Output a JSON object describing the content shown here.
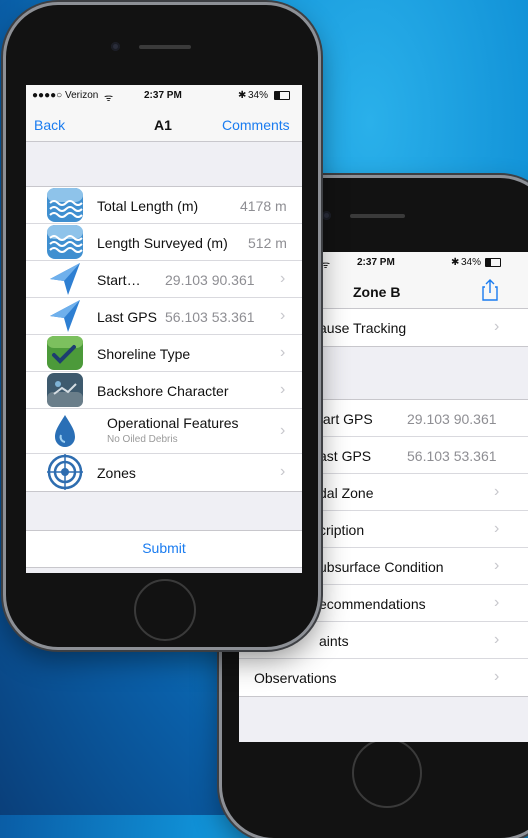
{
  "colors": {
    "accent": "#1a7cf0",
    "background": "#0c78c8"
  },
  "phone_front": {
    "status": {
      "carrier": "●●●●○ Verizon",
      "wifi_icon": "wifi-icon",
      "time": "2:37 PM",
      "bluetooth": "✱",
      "battery": "34%"
    },
    "nav": {
      "back": "Back",
      "title": "A1",
      "comments": "Comments"
    },
    "rows": [
      {
        "icon": "water-waves-icon",
        "label": "Total Length (m)",
        "value": "4178 m"
      },
      {
        "icon": "water-waves-icon",
        "label": "Length Surveyed (m)",
        "value": "512 m"
      },
      {
        "icon": "location-arrow-icon",
        "label": "Start…",
        "value": "29.103 90.361"
      },
      {
        "icon": "location-arrow-icon",
        "label": "Last GPS",
        "value": "56.103 53.361"
      },
      {
        "icon": "shoreline-photo-icon",
        "label": "Shoreline Type",
        "value": ""
      },
      {
        "icon": "backshore-photo-icon",
        "label": "Backshore Character",
        "value": ""
      },
      {
        "icon": "oil-drop-icon",
        "label": "Operational Features",
        "sublabel": "No Oiled Debris",
        "value": ""
      },
      {
        "icon": "target-icon",
        "label": "Zones",
        "value": ""
      }
    ],
    "submit": "Submit"
  },
  "phone_back": {
    "status": {
      "time": "2:37 PM",
      "bluetooth": "✱",
      "battery": "34%"
    },
    "nav": {
      "title": "Zone B",
      "share_icon": "share-icon"
    },
    "group1": [
      {
        "label": "ause Tracking"
      }
    ],
    "group2": [
      {
        "label": "tart GPS",
        "value": "29.103 90.361"
      },
      {
        "label": "ast GPS",
        "value": "56.103 53.361"
      },
      {
        "label": "dal Zone",
        "value": ""
      },
      {
        "label": "cription",
        "value": ""
      },
      {
        "label": "ubsurface Condition",
        "value": ""
      },
      {
        "label": "ecommendations",
        "value": ""
      },
      {
        "label": "aints",
        "value": ""
      },
      {
        "label": "Observations",
        "value": ""
      }
    ]
  }
}
